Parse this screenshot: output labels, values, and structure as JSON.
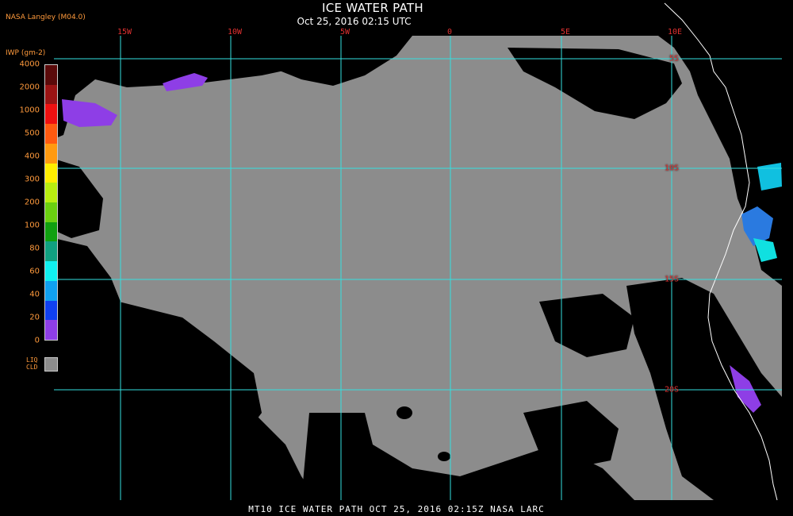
{
  "header": {
    "title": "ICE WATER PATH",
    "subtitle": "Oct 25, 2016 02:15 UTC",
    "org": "NASA Langley (M04.0)"
  },
  "map": {
    "lon_labels": [
      "15W",
      "10W",
      "5W",
      "0",
      "5E",
      "10E"
    ],
    "lat_labels": [
      "5S",
      "10S",
      "15S",
      "20S"
    ],
    "colors": {
      "grid": "#33e0e0",
      "land": "#000000",
      "cloud": "#8c8c8c",
      "ice": "#8e3ee6",
      "coast": "#ffffff",
      "label": "#e03030"
    }
  },
  "legend": {
    "title": "IWP (gm-2)",
    "ticks": [
      "4000",
      "2000",
      "1000",
      "500",
      "400",
      "300",
      "200",
      "100",
      "80",
      "60",
      "40",
      "20",
      "0"
    ],
    "colors": [
      "#5a0a0a",
      "#9a1414",
      "#ee1010",
      "#ff5a10",
      "#ff9a10",
      "#ffee00",
      "#b8ee10",
      "#6ad010",
      "#10a010",
      "#10a080",
      "#10f0f0",
      "#10a0f0",
      "#1040f0",
      "#8e3ee6"
    ],
    "liquid_label": [
      "LIQ",
      "CLD"
    ]
  },
  "footer": "MT10  ICE WATER PATH  OCT 25, 2016 02:15Z  NASA LARC"
}
